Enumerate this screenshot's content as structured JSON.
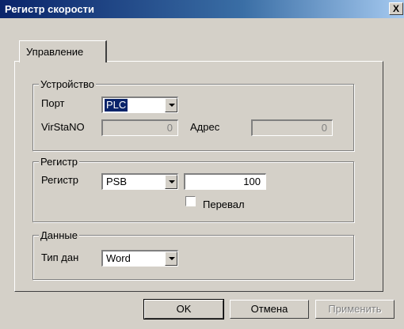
{
  "window": {
    "title": "Регистр скорости",
    "close_label": "X"
  },
  "tabs": [
    {
      "label": "Управление"
    }
  ],
  "device_group": {
    "legend": "Устройство",
    "port_label": "Порт",
    "port_value": "PLC",
    "virstano_label": "VirStaNO",
    "virstano_value": "0",
    "address_label": "Адрес",
    "address_value": "0"
  },
  "register_group": {
    "legend": "Регистр",
    "register_label": "Регистр",
    "register_type": "PSB",
    "register_address": "100",
    "real_label": "Перевал",
    "real_checked": false
  },
  "data_group": {
    "legend": "Данные",
    "type_label": "Тип дан",
    "type_value": "Word"
  },
  "buttons": {
    "ok": "OK",
    "cancel": "Отмена",
    "apply": "Применить"
  }
}
